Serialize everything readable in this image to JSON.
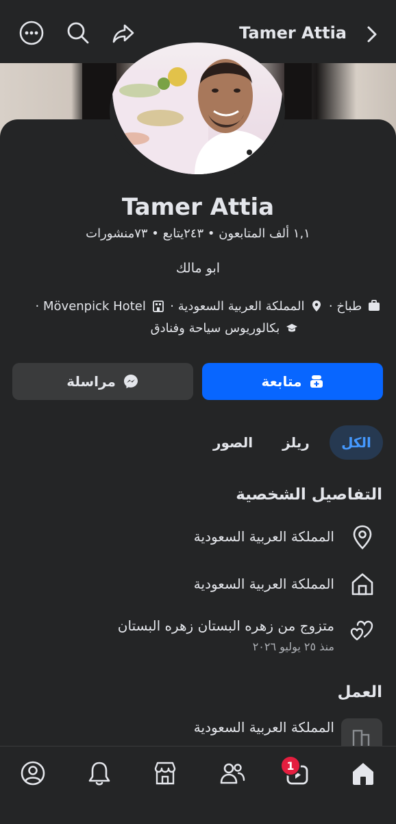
{
  "header": {
    "title": "Tamer Attia",
    "back_icon": "chevron-right-icon",
    "share_icon": "share-icon",
    "search_icon": "search-icon",
    "more_icon": "more-icon"
  },
  "profile": {
    "name": "Tamer Attia",
    "stats": "١,١ ألف المتابعون • ٢٤٣يتابع • ٧٣منشورات",
    "bio": "ابو مالك",
    "meta_job": "طباخ",
    "meta_location": "المملكة العربية السعودية",
    "meta_workplace": "Mövenpick Hotel",
    "meta_education": "بكالوريوس سياحة وفنادق",
    "separator": "·"
  },
  "actions": {
    "follow_label": "متابعة",
    "message_label": "مراسلة",
    "accent_color": "#0866ff"
  },
  "tabs": [
    {
      "label": "الكل",
      "active": true
    },
    {
      "label": "ريلز",
      "active": false
    },
    {
      "label": "الصور",
      "active": false
    }
  ],
  "personal_details": {
    "title": "التفاصيل الشخصية",
    "items": [
      {
        "icon": "location-pin-icon",
        "text": "المملكة العربية السعودية"
      },
      {
        "icon": "home-icon",
        "text": "المملكة العربية السعودية"
      },
      {
        "icon": "relationship-hearts-icon",
        "text": "متزوج من زهره البستان زهره البستان",
        "sub": "منذ ٢٥ يوليو ٢٠٢٦"
      }
    ]
  },
  "work": {
    "title": "العمل",
    "items": [
      {
        "icon": "workplace-icon",
        "text": "المملكة العربية السعودية"
      }
    ]
  },
  "bottom_nav": {
    "items": [
      "home-icon",
      "video-icon",
      "friends-icon",
      "marketplace-icon",
      "notifications-icon",
      "profile-icon"
    ],
    "video_badge": "1"
  }
}
